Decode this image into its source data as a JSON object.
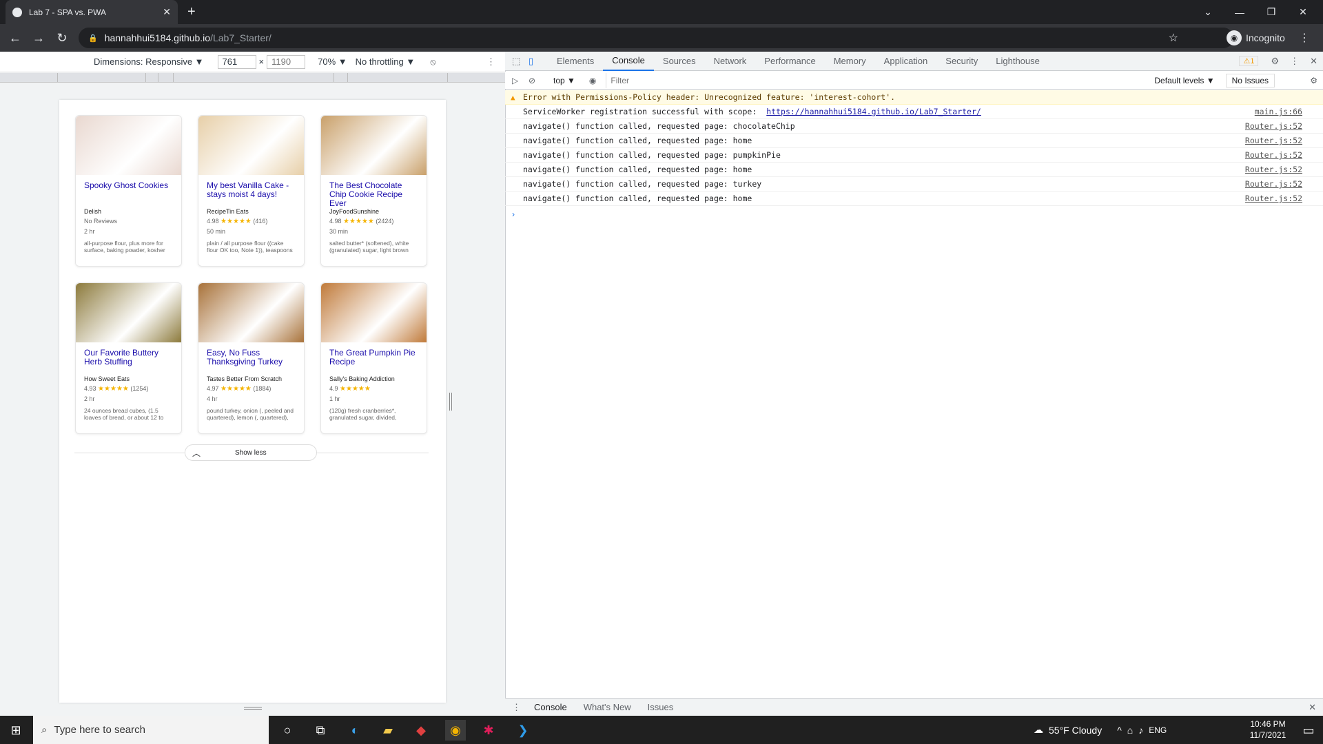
{
  "browser": {
    "tab_title": "Lab 7 - SPA vs. PWA",
    "url_host": "hannahhui5184.github.io",
    "url_path": "/Lab7_Starter/",
    "incognito_label": "Incognito"
  },
  "device_toolbar": {
    "dimensions_label": "Dimensions: Responsive ▼",
    "width": "761",
    "times": "×",
    "height": "1190",
    "zoom": "70% ▼",
    "throttling": "No throttling ▼"
  },
  "recipes": [
    {
      "title": "Spooky Ghost Cookies",
      "source": "Delish",
      "rating": "No Reviews",
      "stars": "",
      "count": "",
      "time": "2 hr",
      "ingredients": "all-purpose flour, plus more for surface, baking powder, kosher",
      "color": "#e9d8d0"
    },
    {
      "title": "My best Vanilla Cake - stays moist 4 days!",
      "source": "RecipeTin Eats",
      "rating": "4.98",
      "stars": "★★★★★",
      "count": "(416)",
      "time": "50 min",
      "ingredients": "plain / all purpose flour ((cake flour OK too, Note 1)), teaspoons",
      "color": "#e7cfa8"
    },
    {
      "title": "The Best Chocolate Chip Cookie Recipe Ever",
      "source": "JoyFoodSunshine",
      "rating": "4.98",
      "stars": "★★★★★",
      "count": "(2424)",
      "time": "30 min",
      "ingredients": "salted butter* (softened), white (granulated) sugar, light brown",
      "color": "#c9a06a"
    },
    {
      "title": "Our Favorite Buttery Herb Stuffing",
      "source": "How Sweet Eats",
      "rating": "4.93",
      "stars": "★★★★★",
      "count": "(1254)",
      "time": "2 hr",
      "ingredients": "24 ounces bread cubes, (1.5 loaves of bread, or about 12 to",
      "color": "#8c7a3c"
    },
    {
      "title": "Easy, No Fuss Thanksgiving Turkey",
      "source": "Tastes Better From Scratch",
      "rating": "4.97",
      "stars": "★★★★★",
      "count": "(1884)",
      "time": "4 hr",
      "ingredients": "pound turkey, onion (, peeled and quartered), lemon (, quartered),",
      "color": "#a8723a"
    },
    {
      "title": "The Great Pumpkin Pie Recipe",
      "source": "Sally's Baking Addiction",
      "rating": "4.9",
      "stars": "★★★★★",
      "count": "",
      "time": "1 hr",
      "ingredients": "(120g) fresh cranberries*, granulated sugar, divided,",
      "color": "#c07a3a"
    }
  ],
  "show_less": "Show less",
  "devtools": {
    "tabs": [
      "Elements",
      "Console",
      "Sources",
      "Network",
      "Performance",
      "Memory",
      "Application",
      "Security",
      "Lighthouse"
    ],
    "warning_count": "⚠1",
    "context": "top ▼",
    "filter_placeholder": "Filter",
    "levels": "Default levels ▼",
    "issues": "No Issues",
    "messages": [
      {
        "text": "Error with Permissions-Policy header: Unrecognized feature: 'interest-cohort'.",
        "source": "",
        "url": "",
        "warn": true
      },
      {
        "text": "ServiceWorker registration successful with scope:",
        "source": "main.js:66",
        "url": "https://hannahhui5184.github.io/Lab7_Starter/",
        "warn": false
      },
      {
        "text": "navigate() function called, requested page: chocolateChip",
        "source": "Router.js:52",
        "url": "",
        "warn": false
      },
      {
        "text": "navigate() function called, requested page: home",
        "source": "Router.js:52",
        "url": "",
        "warn": false
      },
      {
        "text": "navigate() function called, requested page: pumpkinPie",
        "source": "Router.js:52",
        "url": "",
        "warn": false
      },
      {
        "text": "navigate() function called, requested page: home",
        "source": "Router.js:52",
        "url": "",
        "warn": false
      },
      {
        "text": "navigate() function called, requested page: turkey",
        "source": "Router.js:52",
        "url": "",
        "warn": false
      },
      {
        "text": "navigate() function called, requested page: home",
        "source": "Router.js:52",
        "url": "",
        "warn": false
      }
    ],
    "drawer_tabs": [
      "Console",
      "What's New",
      "Issues"
    ]
  },
  "taskbar": {
    "search_placeholder": "Type here to search",
    "weather": "55°F  Cloudy",
    "lang": "ENG",
    "time": "10:46 PM",
    "date": "11/7/2021"
  }
}
